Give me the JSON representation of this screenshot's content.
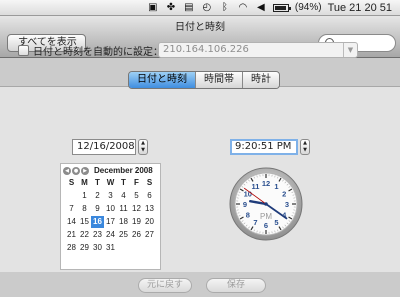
{
  "menubar": {
    "items": [
      {
        "icon": "camera-icon"
      },
      {
        "icon": "paw-icon"
      },
      {
        "icon": "stack-icon"
      },
      {
        "icon": "time-machine-icon"
      },
      {
        "icon": "bluetooth-icon"
      },
      {
        "icon": "wifi-icon"
      },
      {
        "icon": "volume-icon"
      }
    ],
    "battery_label": "(94%)",
    "battery_level": 0.94,
    "clock": "Tue 21 20 51"
  },
  "window": {
    "title": "日付と時刻",
    "show_all_label": "すべてを表示",
    "search_placeholder": ""
  },
  "tabs": [
    {
      "label": "日付と時刻",
      "active": true
    },
    {
      "label": "時間帯",
      "active": false
    },
    {
      "label": "時計",
      "active": false
    }
  ],
  "auto_setting": {
    "label": "日付と時刻を自動的に設定：",
    "checked": false,
    "server": "210.164.106.226"
  },
  "date_field": {
    "value": "12/16/2008"
  },
  "time_field": {
    "value": "9:20:51 PM"
  },
  "calendar": {
    "month_label": "December 2008",
    "weekdays": [
      "S",
      "M",
      "T",
      "W",
      "T",
      "F",
      "S"
    ],
    "days": [
      "",
      "1",
      "2",
      "3",
      "4",
      "5",
      "6",
      "7",
      "8",
      "9",
      "10",
      "11",
      "12",
      "13",
      "14",
      "15",
      "16",
      "17",
      "18",
      "19",
      "20",
      "21",
      "22",
      "23",
      "24",
      "25",
      "26",
      "27",
      "28",
      "29",
      "30",
      "31",
      "",
      "",
      ""
    ],
    "selected_day": "16"
  },
  "clock": {
    "numbers": [
      "12",
      "1",
      "2",
      "3",
      "4",
      "5",
      "6",
      "7",
      "8",
      "9",
      "10",
      "11"
    ],
    "ampm": "PM",
    "hour": 9,
    "minute": 20,
    "second": 51
  },
  "buttons": {
    "revert": "元に戻す",
    "save": "保存"
  }
}
